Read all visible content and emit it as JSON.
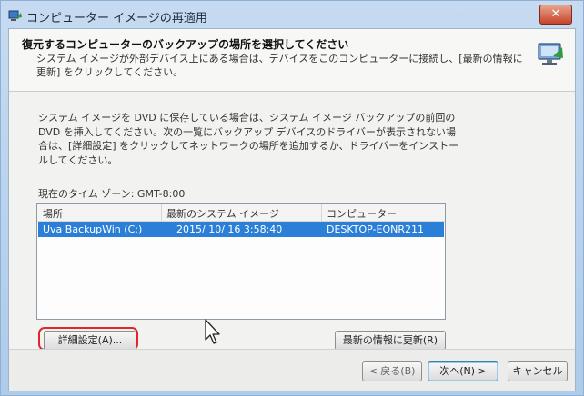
{
  "window": {
    "title": "コンピューター イメージの再適用",
    "close_label": "✕"
  },
  "header": {
    "title": "復元するコンピューターのバックアップの場所を選択してください",
    "description": "システム イメージが外部デバイス上にある場合は、デバイスをこのコンピューターに接続し、[最新の情報に更新] をクリックしてください。"
  },
  "main": {
    "info_text": "システム イメージを DVD に保存している場合は、システム イメージ バックアップの前回の DVD を挿入してください。次の一覧にバックアップ デバイスのドライバーが表示されない場合は、[詳細設定] をクリックしてネットワークの場所を追加するか、ドライバーをインストールしてください。",
    "timezone": "現在のタイム ゾーン: GMT-8:00"
  },
  "table": {
    "columns": [
      "場所",
      "最新のシステム イメージ",
      "コンピューター"
    ],
    "rows": [
      {
        "location": "Uva BackupWin (C:)",
        "latest_image": "2015/ 10/ 16 3:58:40",
        "computer": "DESKTOP-EONR211",
        "selected": true
      }
    ]
  },
  "buttons": {
    "advanced": "詳細設定(A)...",
    "refresh": "最新の情報に更新(R)",
    "back": "< 戻る(B)",
    "next": "次へ(N) >",
    "cancel": "キャンセル"
  },
  "colors": {
    "selection": "#2c7fd6",
    "highlight_ring": "#e0282a",
    "close_button": "#c7432a"
  },
  "icons": {
    "app": "restore-icon",
    "header": "computer-monitor-icon",
    "cursor": "mouse-pointer-icon"
  }
}
